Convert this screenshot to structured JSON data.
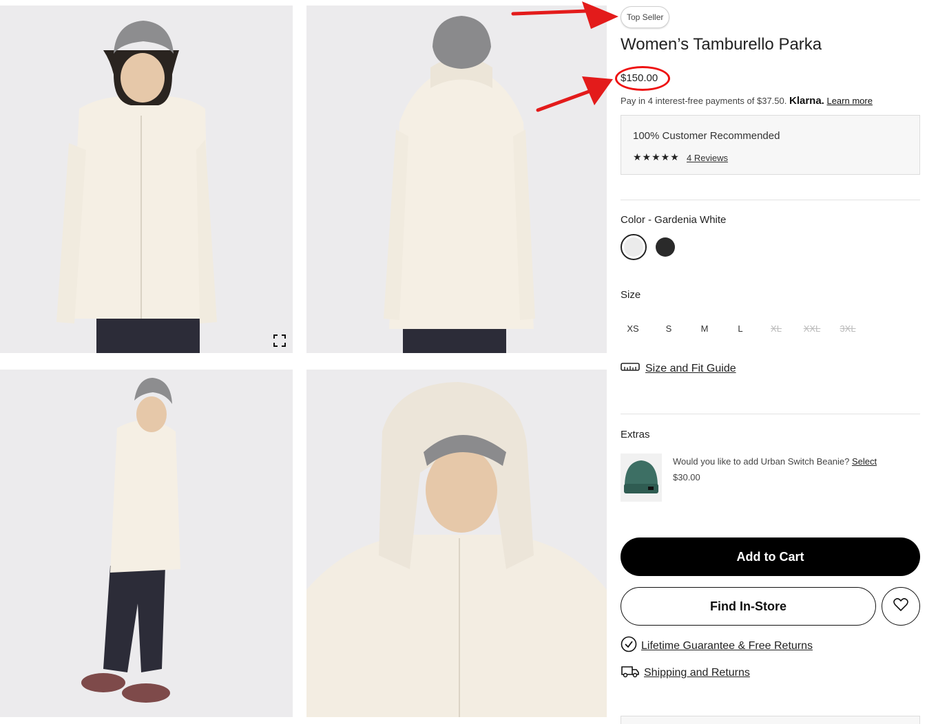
{
  "gallery": {
    "images": [
      {
        "name": "front view"
      },
      {
        "name": "back view"
      },
      {
        "name": "side view"
      },
      {
        "name": "hood detail"
      }
    ]
  },
  "product": {
    "badge": "Top Seller",
    "title": "Women’s Tamburello Parka",
    "price": "$150.00",
    "klarna": {
      "text": "Pay in 4 interest-free payments of $37.50.",
      "brand": "Klarna.",
      "learn_more": "Learn more"
    },
    "recommendation": {
      "text": "100% Customer Recommended",
      "stars": "★★★★★",
      "reviews_link": "4 Reviews"
    },
    "color": {
      "label": "Color - Gardenia White",
      "swatches": [
        {
          "name": "Gardenia White",
          "hex": "#ebebeb",
          "selected": true
        },
        {
          "name": "Black",
          "hex": "#2a2a2a",
          "selected": false
        }
      ]
    },
    "size": {
      "label": "Size",
      "options": [
        {
          "label": "XS",
          "available": true
        },
        {
          "label": "S",
          "available": true
        },
        {
          "label": "M",
          "available": true
        },
        {
          "label": "L",
          "available": true
        },
        {
          "label": "XL",
          "available": false
        },
        {
          "label": "XXL",
          "available": false
        },
        {
          "label": "3XL",
          "available": false
        }
      ]
    },
    "size_guide": "Size and Fit Guide",
    "extras": {
      "label": "Extras",
      "question": "Would you like to add Urban Switch Beanie?",
      "select": "Select",
      "price": "$30.00"
    },
    "add_to_cart": "Add to Cart",
    "find_in_store": "Find In-Store",
    "policies": {
      "guarantee": "Lifetime Guarantee & Free Returns",
      "shipping": "Shipping and Returns"
    }
  },
  "annotations": {
    "color": "#e31b1b"
  }
}
